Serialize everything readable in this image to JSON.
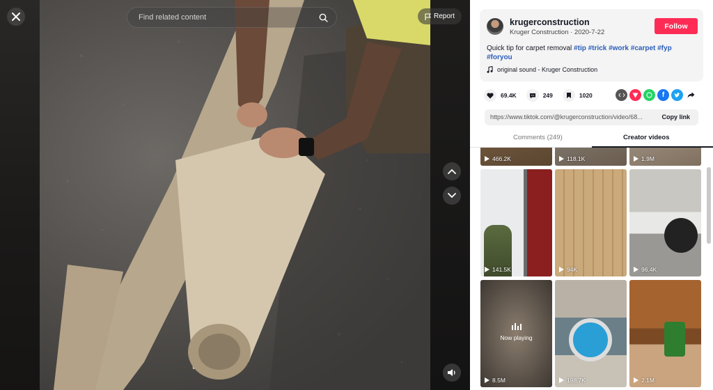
{
  "video": {
    "search_placeholder": "Find related content",
    "report_label": "Report"
  },
  "author": {
    "username": "krugerconstruction",
    "display_line": "Kruger Construction · 2020-7-22",
    "follow_label": "Follow"
  },
  "description": {
    "text": "Quick tip for carpet removal",
    "hashtags": [
      "#tip",
      "#trick",
      "#work",
      "#carpet",
      "#fyp",
      "#foryou"
    ]
  },
  "music": "original sound - Kruger Construction",
  "stats": {
    "likes": "69.4K",
    "comments": "249",
    "saves": "1020"
  },
  "share_icons": [
    "embed-icon",
    "send-to-friends-icon",
    "whatsapp-icon",
    "facebook-icon",
    "twitter-icon",
    "share-arrow-icon"
  ],
  "link": {
    "url": "https://www.tiktok.com/@krugerconstruction/video/68...",
    "copy_label": "Copy link"
  },
  "tabs": {
    "comments": "Comments (249)",
    "creator_videos": "Creator videos",
    "active": "creator_videos"
  },
  "grid": {
    "tiles": [
      {
        "views": "466.2K"
      },
      {
        "views": "118.1K"
      },
      {
        "views": "1.9M"
      },
      {
        "views": "141.5K"
      },
      {
        "views": "94K"
      },
      {
        "views": "96.4K"
      },
      {
        "views": "8.5M",
        "status": "Now playing"
      },
      {
        "views": "198.7K"
      },
      {
        "views": "2.1M"
      }
    ]
  },
  "colors": {
    "follow": "#fe2c55",
    "hashtag": "#2b5db9"
  }
}
